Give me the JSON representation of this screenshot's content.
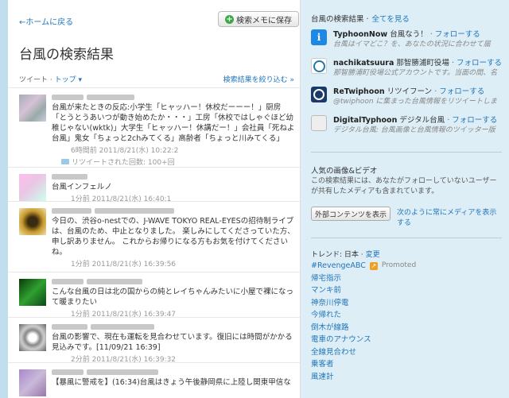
{
  "header": {
    "back_label": "←ホームに戻る",
    "save_button": "検索メモに保存",
    "title": "台風の検索結果"
  },
  "filter": {
    "label": "ツイート ·",
    "top": "トップ ▾",
    "refine": "検索結果を絞り込む »"
  },
  "tweets": [
    {
      "text": "台風が来たときの反応:小学生「ヒャッハー！休校だーーー！」厨房「とうとうあいつが動き始めたか・・・」工房「休校ではしゃぐほど幼稚じゃない(wktk)」大学生「ヒャッハー！休講だー！」会社員「死ねよ台風」鬼女「ちょっと2chみてくる」高齢者「ちょっと川みてくる」",
      "meta": "6時間前 2011/8/21(水) 10:22:2",
      "retweets": "リツイートされた回数: 100+回"
    },
    {
      "text": "台風インフェルノ",
      "meta": "1分前 2011/8/21(水) 16:40:1"
    },
    {
      "text": "今日の、渋谷o-nestでの、J-WAVE TOKYO REAL-EYESの招待制ライブは、台風のため、中止となりました。 楽しみにしてくださっていた方、申し訳ありません。 これからお帰りになる方もお気を付けてください ね。",
      "meta": "1分前 2011/8/21(水) 16:39:56"
    },
    {
      "text": "こんな台風の日は北の国からの純とレイちゃんみたいに小屋で裸になって暖まりたい",
      "meta": "1分前 2011/8/21(水) 16:39:47"
    },
    {
      "text": "台風の影響で、現在も運転を見合わせています。復旧には時間がかかる見込みです。[11/09/21 16:39]",
      "meta": "2分前 2011/8/21(水) 16:39:32"
    },
    {
      "text": "【暴風に警戒を】(16:34)台風はきょう午後静岡県に上陸し関東甲信な",
      "meta": ""
    }
  ],
  "sidebar": {
    "section_title": "台風の検索結果 ·",
    "see_all": "全てを見る",
    "accounts": [
      {
        "name": "TyphoonNow",
        "handle": "台風なう！",
        "follow": "· フォローする",
        "bio": "台風はイマどこ？を、あなたの状況に合わせて届",
        "icon": "info-icon"
      },
      {
        "name": "nachikatsuura",
        "handle": "那智勝浦町役場",
        "follow": "· フォローする",
        "bio": "那智勝浦町役場公式アカウントです。当面の間、名",
        "icon": "circle-icon"
      },
      {
        "name": "ReTwiphoon",
        "handle": "リツイフーン",
        "follow": "· フォローする",
        "bio": "@twiphoon に集まった台風情報をリツイートしま",
        "icon": "swirl-icon"
      },
      {
        "name": "DigitalTyphoon",
        "handle": "デジタル台風",
        "follow": "· フォローする",
        "bio": "デジタル台風: 台風画像と台風情報のツイッター版",
        "icon": "typhoon-icon"
      }
    ],
    "media": {
      "title": "人気の画像&ビデオ",
      "description": "この検索結果には、あなたがフォローしていないユーザーが共有したメディアも含まれています。",
      "button": "外部コンテンツを表示",
      "always_link": "次のように常にメディアを表示する"
    },
    "trends": {
      "label": "トレンド: 日本 ·",
      "change": "変更",
      "items": [
        "#RevengeABC",
        "帰宅指示",
        "マンキ前",
        "神奈川停電",
        "今帰れた",
        "倒木が線路",
        "電車のアナウンス",
        "全線見合わせ",
        "乗客者",
        "風速計"
      ],
      "promoted": "Promoted"
    }
  },
  "colors": {
    "link": "#2276bb",
    "background": "#c0deed",
    "sidebar": "#ddeef6"
  }
}
